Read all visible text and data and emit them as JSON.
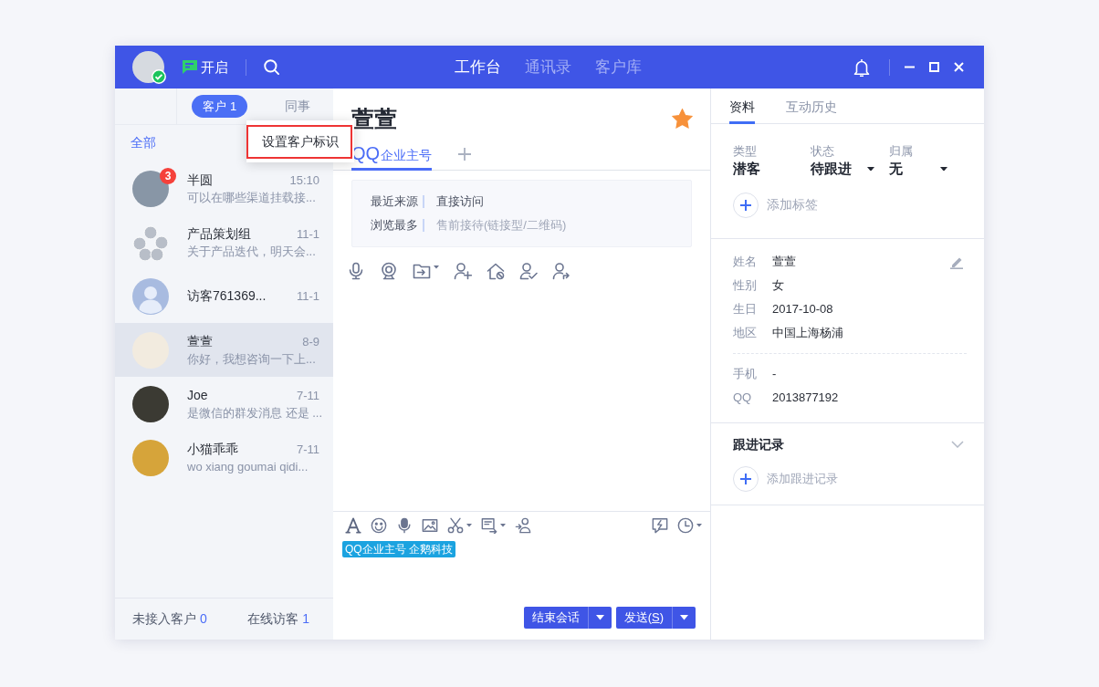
{
  "top_bar": {
    "user": {
      "online": true
    },
    "status_toggle": {
      "label": "开启"
    },
    "nav": [
      {
        "label": "工作台",
        "selected": true
      },
      {
        "label": "通讯录",
        "selected": false
      },
      {
        "label": "客户库",
        "selected": false
      }
    ]
  },
  "sidebar": {
    "tabs": [
      {
        "label": "客户",
        "count": "1",
        "selected": true
      },
      {
        "label": "同事",
        "selected": false
      }
    ],
    "filter": "全部",
    "context_menu": [
      {
        "label": "设置客户标识",
        "highlighted": true
      }
    ],
    "conversations": [
      {
        "name": "半圆",
        "time": "15:10",
        "preview": "可以在哪些渠道挂载接...",
        "unread": "3",
        "avatar": {
          "kind": "photo",
          "color": "#8896a6"
        },
        "selected": false
      },
      {
        "name": "产品策划组",
        "time": "11-1",
        "preview": "关于产品迭代，明天会...",
        "avatar": {
          "kind": "group",
          "color": "#b8bec8"
        },
        "selected": false
      },
      {
        "name": "访客761369...",
        "time": "11-1",
        "avatar": {
          "kind": "default",
          "color": "#a8bbe0"
        },
        "selected": false
      },
      {
        "name": "萱萱",
        "time": "8-9",
        "preview": "你好，我想咨询一下上...",
        "avatar": {
          "kind": "photo",
          "color": "#f2ebdf"
        },
        "selected": true
      },
      {
        "name": "Joe",
        "time": "7-11",
        "preview": "是微信的群发消息 还是 ...",
        "avatar": {
          "kind": "photo",
          "color": "#3b3a33"
        },
        "selected": false
      },
      {
        "name": "小猫乖乖",
        "time": "7-11",
        "preview": "wo xiang goumai qidi...",
        "avatar": {
          "kind": "photo",
          "color": "#d6a43a"
        },
        "selected": false
      }
    ],
    "footer": [
      {
        "label": "未接入客户",
        "count": "0"
      },
      {
        "label": "在线访客",
        "count": "1"
      }
    ]
  },
  "chat": {
    "title": "萱萱",
    "starred": true,
    "channels": [
      {
        "prefix": "QQ",
        "label": "企业主号",
        "selected": true
      }
    ],
    "source_info": [
      {
        "label": "最近来源",
        "value": "直接访问",
        "muted": false
      },
      {
        "label": "浏览最多",
        "value": "售前接待(链接型/二维码)",
        "muted": true
      }
    ],
    "composer": {
      "tag": "QQ企业主号 企鹅科技",
      "buttons": [
        {
          "label": "结束会话"
        },
        {
          "label": "发送(",
          "access_key": "S",
          "label_after": ")"
        }
      ]
    }
  },
  "profile": {
    "tabs": [
      {
        "label": "资料",
        "selected": true
      },
      {
        "label": "互动历史",
        "selected": false
      }
    ],
    "status_fields": [
      {
        "label": "类型",
        "value": "潜客",
        "dropdown": false
      },
      {
        "label": "状态",
        "value": "待跟进",
        "dropdown": true
      },
      {
        "label": "归属",
        "value": "无",
        "dropdown": true
      }
    ],
    "add_tag": "添加标签",
    "basic_info": [
      {
        "label": "姓名",
        "value": "萱萱"
      },
      {
        "label": "性别",
        "value": "女"
      },
      {
        "label": "生日",
        "value": "2017-10-08"
      },
      {
        "label": "地区",
        "value": "中国上海杨浦"
      }
    ],
    "contact_info": [
      {
        "label": "手机",
        "value": "-"
      },
      {
        "label": "QQ",
        "value": "2013877192"
      }
    ],
    "follow_up": {
      "title": "跟进记录",
      "add": "添加跟进记录"
    }
  }
}
